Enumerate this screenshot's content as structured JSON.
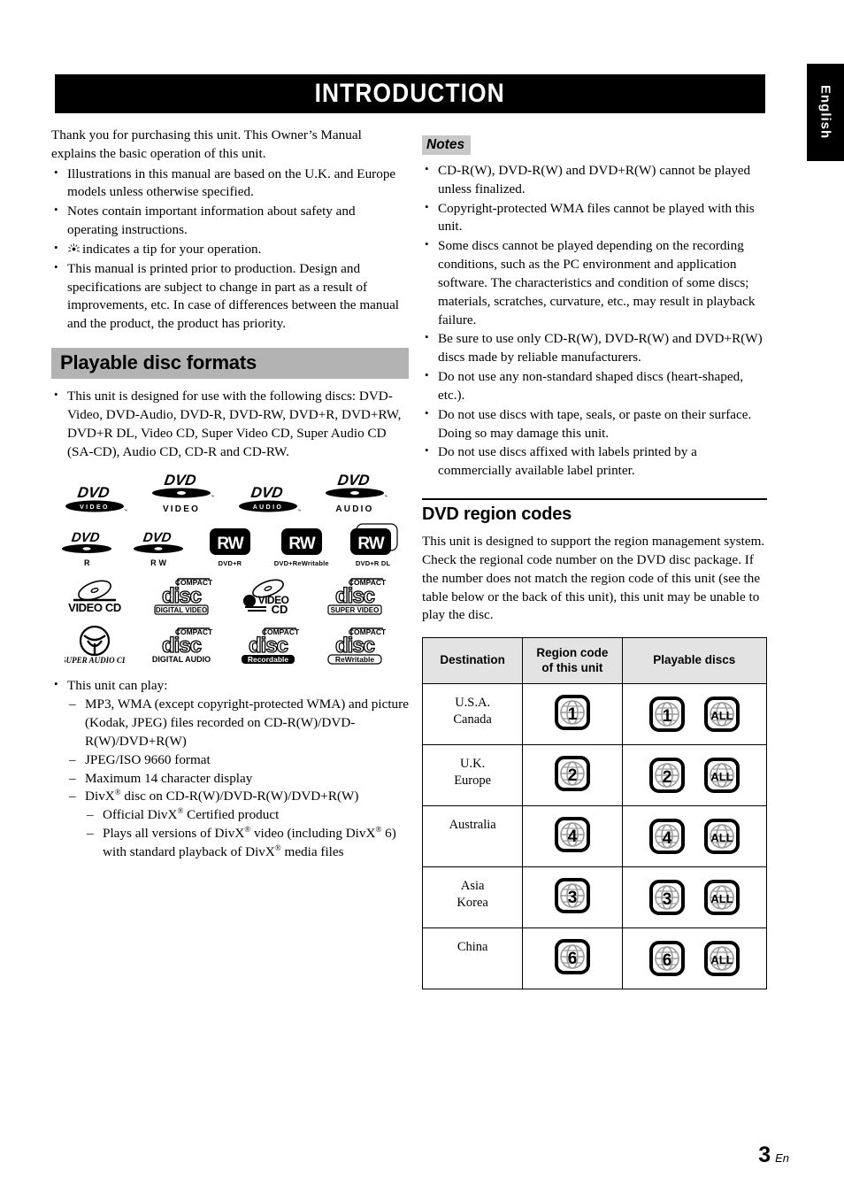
{
  "page": {
    "banner_title": "INTRODUCTION",
    "side_tab_label": "English",
    "footer_page_number": "3",
    "footer_language": "En"
  },
  "left_column": {
    "intro_paragraph": "Thank you for purchasing this unit. This Owner’s Manual explains the basic operation of this unit.",
    "intro_bullets": [
      "Illustrations in this manual are based on the U.K. and Europe models unless otherwise specified.",
      "Notes contain important information about safety and operating instructions.",
      "indicates a tip for your operation.",
      "This manual is printed prior to production. Design and specifications are subject to change in part as a result of improvements, etc. In case of differences between the manual and the product, the product has priority."
    ],
    "section_heading": "Playable disc formats",
    "discs_bullet": "This unit is designed for use with the following discs: DVD-Video, DVD-Audio, DVD-R, DVD-RW, DVD+R, DVD+RW, DVD+R DL, Video CD, Super Video CD, Super Audio CD (SA-CD), Audio CD, CD-R and CD-RW.",
    "logo_rows": [
      [
        {
          "name": "dvd-video-logo",
          "top": "DVD",
          "inner": "VIDEO",
          "caption": ""
        },
        {
          "name": "dvd-video-logo-alt",
          "top": "DVD",
          "inner": "",
          "caption": "VIDEO"
        },
        {
          "name": "dvd-audio-logo",
          "top": "DVD",
          "inner": "AUDIO",
          "caption": ""
        },
        {
          "name": "dvd-audio-logo-alt",
          "top": "DVD",
          "inner": "",
          "caption": "AUDIO"
        }
      ],
      [
        {
          "name": "dvd-r-logo",
          "top": "DVD",
          "inner": "",
          "caption": "R"
        },
        {
          "name": "dvd-rw-logo",
          "top": "DVD",
          "inner": "",
          "caption": "R W"
        },
        {
          "name": "dvd-plus-r-logo",
          "top": "RW",
          "inner": "",
          "caption": "DVD+R"
        },
        {
          "name": "dvd-plus-rewritable-logo",
          "top": "RW",
          "inner": "",
          "caption": "DVD+ReWritable"
        },
        {
          "name": "dvd-plus-r-dl-logo",
          "top": "RW",
          "inner": "",
          "caption": "DVD+R DL"
        }
      ],
      [
        {
          "name": "video-cd-logo",
          "top": "",
          "inner": "",
          "caption": "VIDEO CD"
        },
        {
          "name": "compact-disc-digital-video-logo",
          "top": "COMPACT",
          "inner": "disc",
          "caption": "DIGITAL VIDEO"
        },
        {
          "name": "super-video-cd-logo",
          "top": "",
          "inner": "VIDEO",
          "caption": "CD"
        },
        {
          "name": "compact-disc-super-video-logo",
          "top": "COMPACT",
          "inner": "disc",
          "caption": "SUPER VIDEO"
        }
      ],
      [
        {
          "name": "super-audio-cd-logo",
          "top": "",
          "inner": "",
          "caption": "SUPER AUDIO CD"
        },
        {
          "name": "compact-disc-digital-audio-logo",
          "top": "COMPACT",
          "inner": "disc",
          "caption": "DIGITAL AUDIO"
        },
        {
          "name": "compact-disc-recordable-logo",
          "top": "COMPACT",
          "inner": "disc",
          "caption": "Recordable"
        },
        {
          "name": "compact-disc-rewritable-logo",
          "top": "COMPACT",
          "inner": "disc",
          "caption": "ReWritable"
        }
      ]
    ],
    "can_play_heading": "This unit can play:",
    "can_play_items": [
      "MP3, WMA (except copyright-protected WMA) and picture (Kodak, JPEG) files recorded on CD-R(W)/DVD-R(W)/DVD+R(W)",
      "JPEG/ISO 9660 format",
      "Maximum 14 character display"
    ],
    "divx_item_pre": "DivX",
    "divx_item_post": " disc on CD-R(W)/DVD-R(W)/DVD+R(W)",
    "divx_sub_items": [
      {
        "pre": "Official DivX",
        "post": " Certified product"
      },
      {
        "pre": "Plays all versions of DivX",
        "mid": " video (including DivX",
        "mid2": " 6) with standard playback of DivX",
        "post": " media files"
      }
    ]
  },
  "right_column": {
    "notes_heading": "Notes",
    "notes": [
      "CD-R(W), DVD-R(W) and DVD+R(W) cannot be played unless finalized.",
      "Copyright-protected WMA files cannot be played with this unit.",
      "Some discs cannot be played depending on the recording conditions, such as the PC environment and application software. The characteristics and condition of some discs; materials, scratches, curvature, etc., may result in playback failure.",
      "Be sure to use only CD-R(W), DVD-R(W) and DVD+R(W) discs made by reliable manufacturers.",
      "Do not use any non-standard shaped discs (heart-shaped, etc.).",
      "Do not use discs with tape, seals, or paste on their surface. Doing so may damage this unit.",
      "Do not use discs affixed with labels printed by a commercially available label printer."
    ],
    "region_heading": "DVD region codes",
    "region_paragraph": "This unit is designed to support the region management system. Check the regional code number on the DVD disc package. If the number does not match the region code of this unit (see the table below or the back of this unit), this unit may be unable to play the disc.",
    "region_table": {
      "headers": [
        "Destination",
        "Region code\nof this unit",
        "Playable discs"
      ],
      "header_destination": "Destination",
      "header_region_code_line1": "Region code",
      "header_region_code_line2": "of this unit",
      "header_playable_discs": "Playable discs",
      "rows": [
        {
          "destination_line1": "U.S.A.",
          "destination_line2": "Canada",
          "code": "1",
          "playable": [
            "1",
            "ALL"
          ]
        },
        {
          "destination_line1": "U.K.",
          "destination_line2": "Europe",
          "code": "2",
          "playable": [
            "2",
            "ALL"
          ]
        },
        {
          "destination_line1": "Australia",
          "destination_line2": "",
          "code": "4",
          "playable": [
            "4",
            "ALL"
          ]
        },
        {
          "destination_line1": "Asia",
          "destination_line2": "Korea",
          "code": "3",
          "playable": [
            "3",
            "ALL"
          ]
        },
        {
          "destination_line1": "China",
          "destination_line2": "",
          "code": "6",
          "playable": [
            "6",
            "ALL"
          ]
        }
      ]
    }
  },
  "colors": {
    "banner_bg": "#000000",
    "gray_heading_bg": "#b3b3b3",
    "notes_heading_bg": "#c8c8c8",
    "table_header_bg": "#e3e3e3"
  }
}
